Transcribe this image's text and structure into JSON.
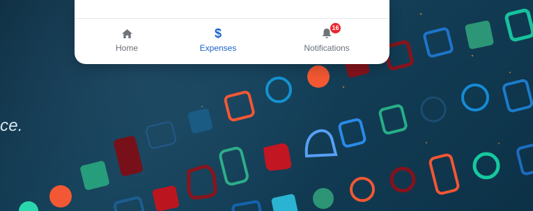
{
  "caption": {
    "fragment": "ce."
  },
  "bottom_nav": {
    "items": [
      {
        "label": "Home",
        "icon": "home-icon",
        "active": false
      },
      {
        "label": "Expenses",
        "icon": "dollar-icon",
        "active": true
      },
      {
        "label": "Notifications",
        "icon": "bell-icon",
        "active": false,
        "badge": "16"
      }
    ]
  },
  "colors": {
    "background": "#123a50",
    "card": "#ffffff",
    "active": "#1c62c9",
    "inactive": "#686f77",
    "badge": "#e9262d"
  }
}
